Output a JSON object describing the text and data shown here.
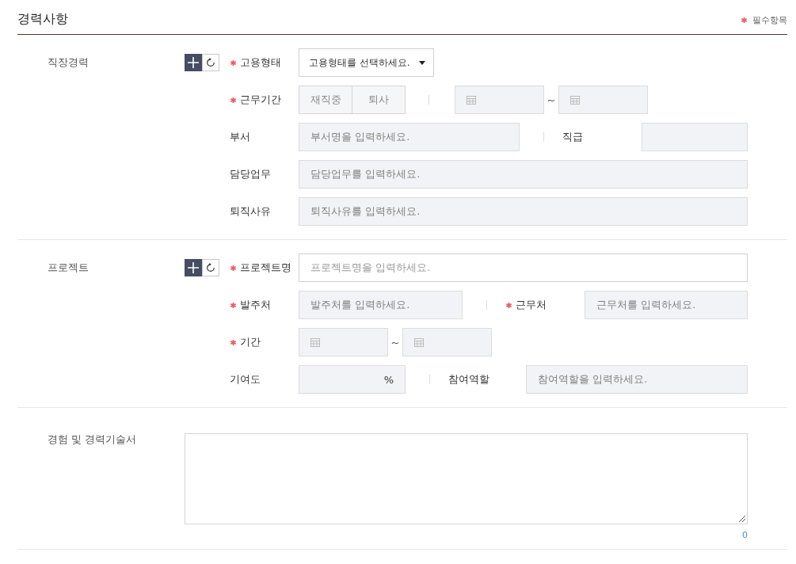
{
  "title": "경력사항",
  "required_note": "필수항목",
  "sections": [
    {
      "label": "직장경력",
      "kind": "fields",
      "rows": [
        {
          "kind": "select",
          "fields": [
            {
              "label": "고용형태",
              "required": true,
              "disabled": false,
              "value": "고용형태를 선택하세요."
            }
          ]
        },
        {
          "kind": "period",
          "fields": [
            {
              "label": "근무기간",
              "required": true,
              "disabled": true
            }
          ],
          "toggles": [
            {
              "label": "재직중",
              "selected": false
            },
            {
              "label": "퇴사",
              "selected": false
            }
          ],
          "separator": "~"
        },
        {
          "kind": "pair",
          "fields": [
            {
              "label": "부서",
              "required": false,
              "disabled": true,
              "placeholder": "부서명을 입력하세요."
            },
            {
              "label": "직급",
              "required": false,
              "disabled": true
            }
          ]
        },
        {
          "kind": "input",
          "fields": [
            {
              "label": "담당업무",
              "required": false,
              "disabled": true,
              "placeholder": "담당업무를 입력하세요."
            }
          ]
        },
        {
          "kind": "input",
          "fields": [
            {
              "label": "퇴직사유",
              "required": false,
              "disabled": true,
              "placeholder": "퇴직사유를 입력하세요."
            }
          ]
        }
      ]
    },
    {
      "label": "프로젝트",
      "kind": "fields",
      "rows": [
        {
          "kind": "input",
          "fields": [
            {
              "label": "프로젝트명",
              "required": true,
              "disabled": false,
              "placeholder": "프로젝트명을 입력하세요."
            }
          ]
        },
        {
          "kind": "pair",
          "fields": [
            {
              "label": "발주처",
              "required": true,
              "disabled": true,
              "placeholder": "발주처를 입력하세요."
            },
            {
              "label": "근무처",
              "required": true,
              "disabled": true,
              "placeholder": "근무처를 입력하세요."
            }
          ]
        },
        {
          "kind": "dates",
          "fields": [
            {
              "label": "기간",
              "required": true,
              "disabled": true
            }
          ],
          "separator": "~"
        },
        {
          "kind": "pair",
          "fields": [
            {
              "label": "기여도",
              "required": false,
              "disabled": true,
              "unit": "%"
            },
            {
              "label": "참여역할",
              "required": false,
              "disabled": true,
              "placeholder": "참여역할을 입력하세요."
            }
          ]
        }
      ]
    },
    {
      "label": "경험 및 경력기술서",
      "kind": "textarea",
      "counter": "0"
    }
  ]
}
